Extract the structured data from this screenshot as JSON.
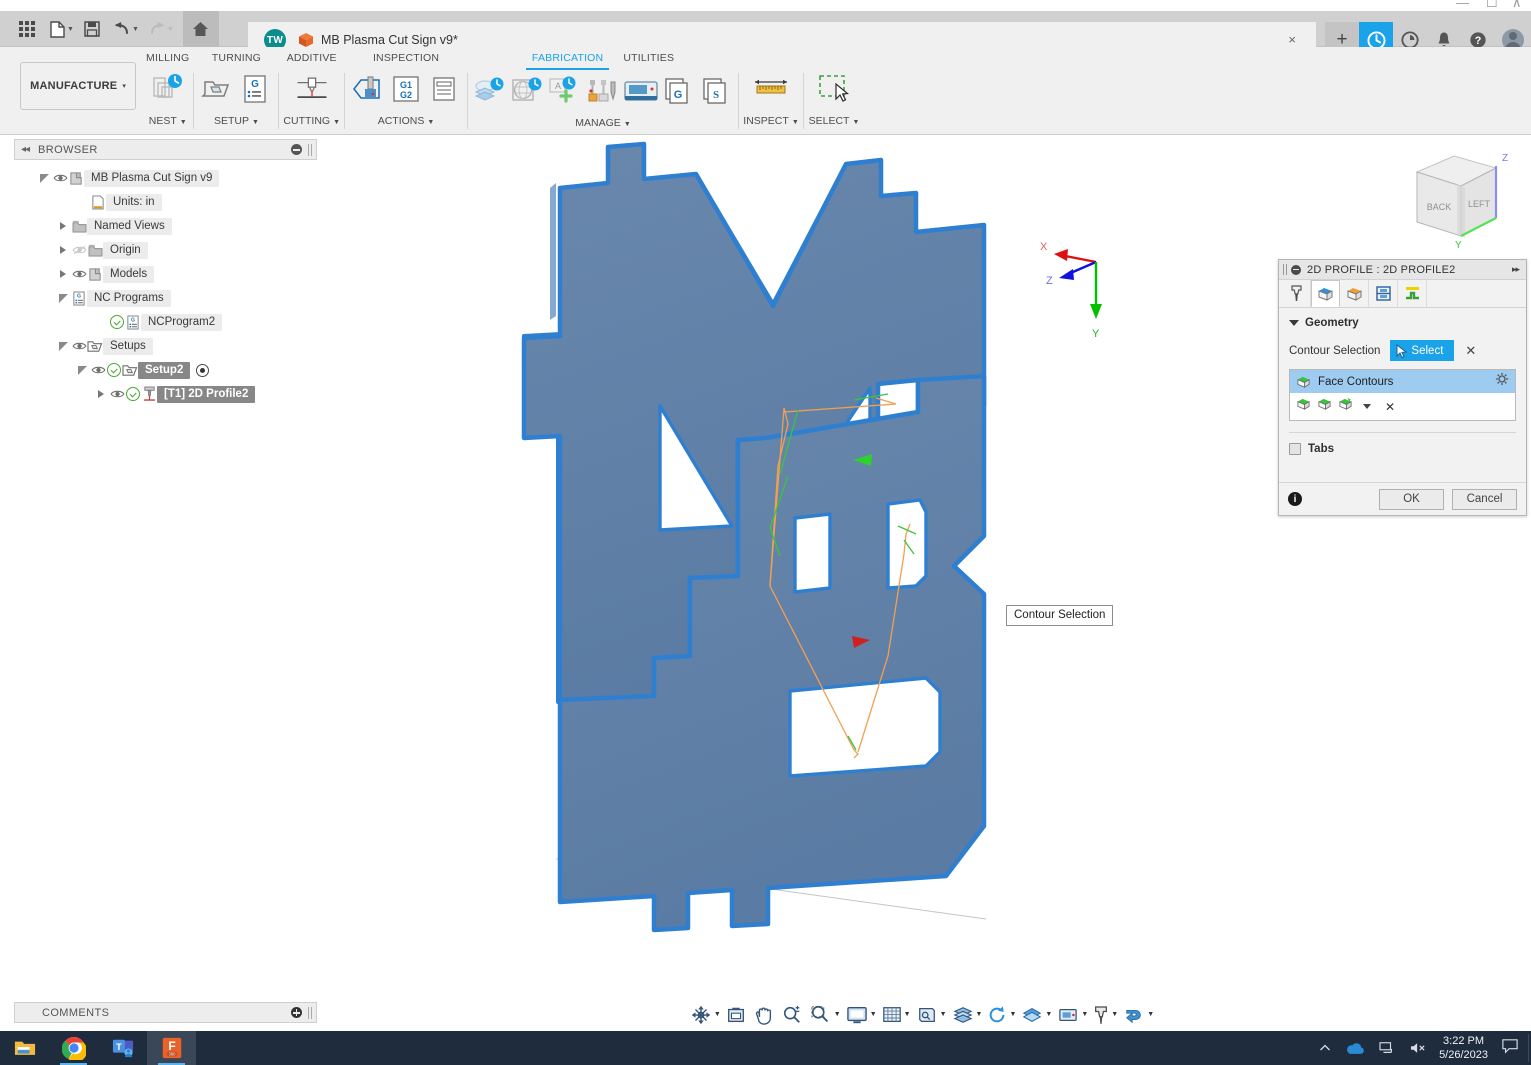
{
  "window": {
    "minimize": "–",
    "maximize": "▫",
    "restore": "∧"
  },
  "quick_access": {
    "grid_icon": "app-grid-icon",
    "new_label": "new-document",
    "save_label": "save",
    "undo_label": "undo",
    "redo_label": "redo",
    "home_label": "home"
  },
  "document_tab": {
    "avatar_initials": "TW",
    "title": "MB Plasma Cut Sign v9*",
    "close": "×"
  },
  "title_right": {
    "new_tab": "+",
    "job_status": "job-status-icon",
    "recent": "recent-icon",
    "notifications": "notifications-icon",
    "help": "help-icon",
    "account": "account-avatar"
  },
  "ribbon": {
    "workspace": "MANUFACTURE",
    "workspace_caret": "▾",
    "panels": [
      {
        "head": "MILLING",
        "foot": "NEST",
        "active": false
      },
      {
        "head": "TURNING",
        "foot": "SETUP",
        "active": false
      },
      {
        "head": "ADDITIVE",
        "foot": "CUTTING",
        "active": false
      },
      {
        "head": "INSPECTION",
        "foot": "ACTIONS",
        "active": false
      },
      {
        "head": "FABRICATION",
        "foot": "MANAGE",
        "active": true
      },
      {
        "head": "UTILITIES",
        "foot": "INSPECT",
        "active": false
      },
      {
        "head": "",
        "foot": "SELECT",
        "active": false
      }
    ],
    "caret": "▾"
  },
  "browser": {
    "header": "BROWSER",
    "collapse_icon": "◂◂",
    "tree": [
      {
        "label": "MB Plasma Cut Sign v9",
        "indent": 0,
        "expander": "open",
        "eye": true,
        "check": false,
        "icon": "body-icon",
        "selected": false,
        "radio": false
      },
      {
        "label": "Units: in",
        "indent": 2,
        "expander": "none",
        "eye": false,
        "check": false,
        "icon": "units-icon",
        "selected": false,
        "radio": false
      },
      {
        "label": "Named Views",
        "indent": 1,
        "expander": "closed",
        "eye": false,
        "check": false,
        "icon": "folder-icon",
        "selected": false,
        "radio": false
      },
      {
        "label": "Origin",
        "indent": 1,
        "expander": "closed",
        "eye": "off",
        "check": false,
        "icon": "folder-icon",
        "selected": false,
        "radio": false
      },
      {
        "label": "Models",
        "indent": 1,
        "expander": "closed",
        "eye": true,
        "check": false,
        "icon": "body-icon",
        "selected": false,
        "radio": false
      },
      {
        "label": "NC Programs",
        "indent": 1,
        "expander": "open",
        "eye": false,
        "check": false,
        "icon": "ncprogram-icon",
        "selected": false,
        "radio": false
      },
      {
        "label": "NCProgram2",
        "indent": 3,
        "expander": "none",
        "eye": false,
        "check": true,
        "icon": "ncprogram-icon",
        "selected": false,
        "radio": false
      },
      {
        "label": "Setups",
        "indent": 1,
        "expander": "open",
        "eye": true,
        "check": false,
        "icon": "setup-icon",
        "selected": false,
        "radio": false
      },
      {
        "label": "Setup2",
        "indent": 2,
        "expander": "open",
        "eye": true,
        "check": true,
        "icon": "setup-icon",
        "selected": true,
        "radio": true
      },
      {
        "label": "[T1] 2D Profile2",
        "indent": 3,
        "expander": "closed",
        "eye": true,
        "check": true,
        "icon": "tool-icon",
        "selected": true,
        "radio": false
      }
    ]
  },
  "comments": {
    "header": "COMMENTS"
  },
  "canvas": {
    "viewcube": {
      "face_left": "BACK",
      "face_right": "LEFT",
      "axis_z": "Z",
      "axis_y": "Y"
    },
    "triad": {
      "x": "X",
      "y": "Y",
      "z": "Z"
    },
    "tooltip": "Contour Selection",
    "model_color": "#5d7fa6",
    "edge_color": "#2f7fd1",
    "toolpath_lead_color": "#f0a050",
    "toolpath_cut_color": "#3cc43c"
  },
  "dialog": {
    "title": "2D PROFILE : 2D PROFILE2",
    "expand_icon": "▸▸",
    "tabs": [
      {
        "name": "tool-tab",
        "label": "Tool",
        "active": false
      },
      {
        "name": "geometry-tab",
        "label": "Geometry",
        "active": true
      },
      {
        "name": "heights-tab",
        "label": "Heights",
        "active": false
      },
      {
        "name": "passes-tab",
        "label": "Passes",
        "active": false
      },
      {
        "name": "linking-tab",
        "label": "Linking",
        "active": false
      }
    ],
    "geometry_group": "Geometry",
    "contour_selection_label": "Contour Selection",
    "select_button": "Select",
    "clear_selection": "✕",
    "selection_item": "Face Contours",
    "tools_clear": "✕",
    "tabs_checkbox_label": "Tabs",
    "ok": "OK",
    "cancel": "Cancel",
    "info": "i"
  },
  "navbar": {
    "items": [
      {
        "name": "orbit-icon",
        "caret": true
      },
      {
        "name": "look-at-icon",
        "caret": false
      },
      {
        "name": "pan-icon",
        "caret": false
      },
      {
        "name": "zoom-icon",
        "caret": false
      },
      {
        "name": "zoom-window-icon",
        "caret": true
      },
      {
        "name": "display-settings-icon",
        "caret": true
      },
      {
        "name": "grid-snaps-icon",
        "caret": true
      },
      {
        "name": "viewports-icon",
        "caret": true
      },
      {
        "name": "layers-icon",
        "caret": true
      },
      {
        "name": "refresh-icon",
        "caret": true
      },
      {
        "name": "appearance-icon",
        "caret": true
      },
      {
        "name": "machine-icon",
        "caret": true
      },
      {
        "name": "tool-library-icon",
        "caret": true
      },
      {
        "name": "simulate-icon",
        "caret": true
      }
    ]
  },
  "taskbar": {
    "apps": [
      {
        "name": "file-explorer",
        "active": false,
        "running": false
      },
      {
        "name": "google-chrome",
        "active": false,
        "running": true
      },
      {
        "name": "microsoft-teams",
        "active": false,
        "running": false
      },
      {
        "name": "fusion-360",
        "active": true,
        "running": true
      }
    ],
    "tray": {
      "chevron": "∧",
      "onedrive": "onedrive-icon",
      "network": "network-icon",
      "volume": "volume-muted-icon",
      "time": "3:22 PM",
      "date": "5/26/2023",
      "notifications": "action-center-icon"
    }
  }
}
